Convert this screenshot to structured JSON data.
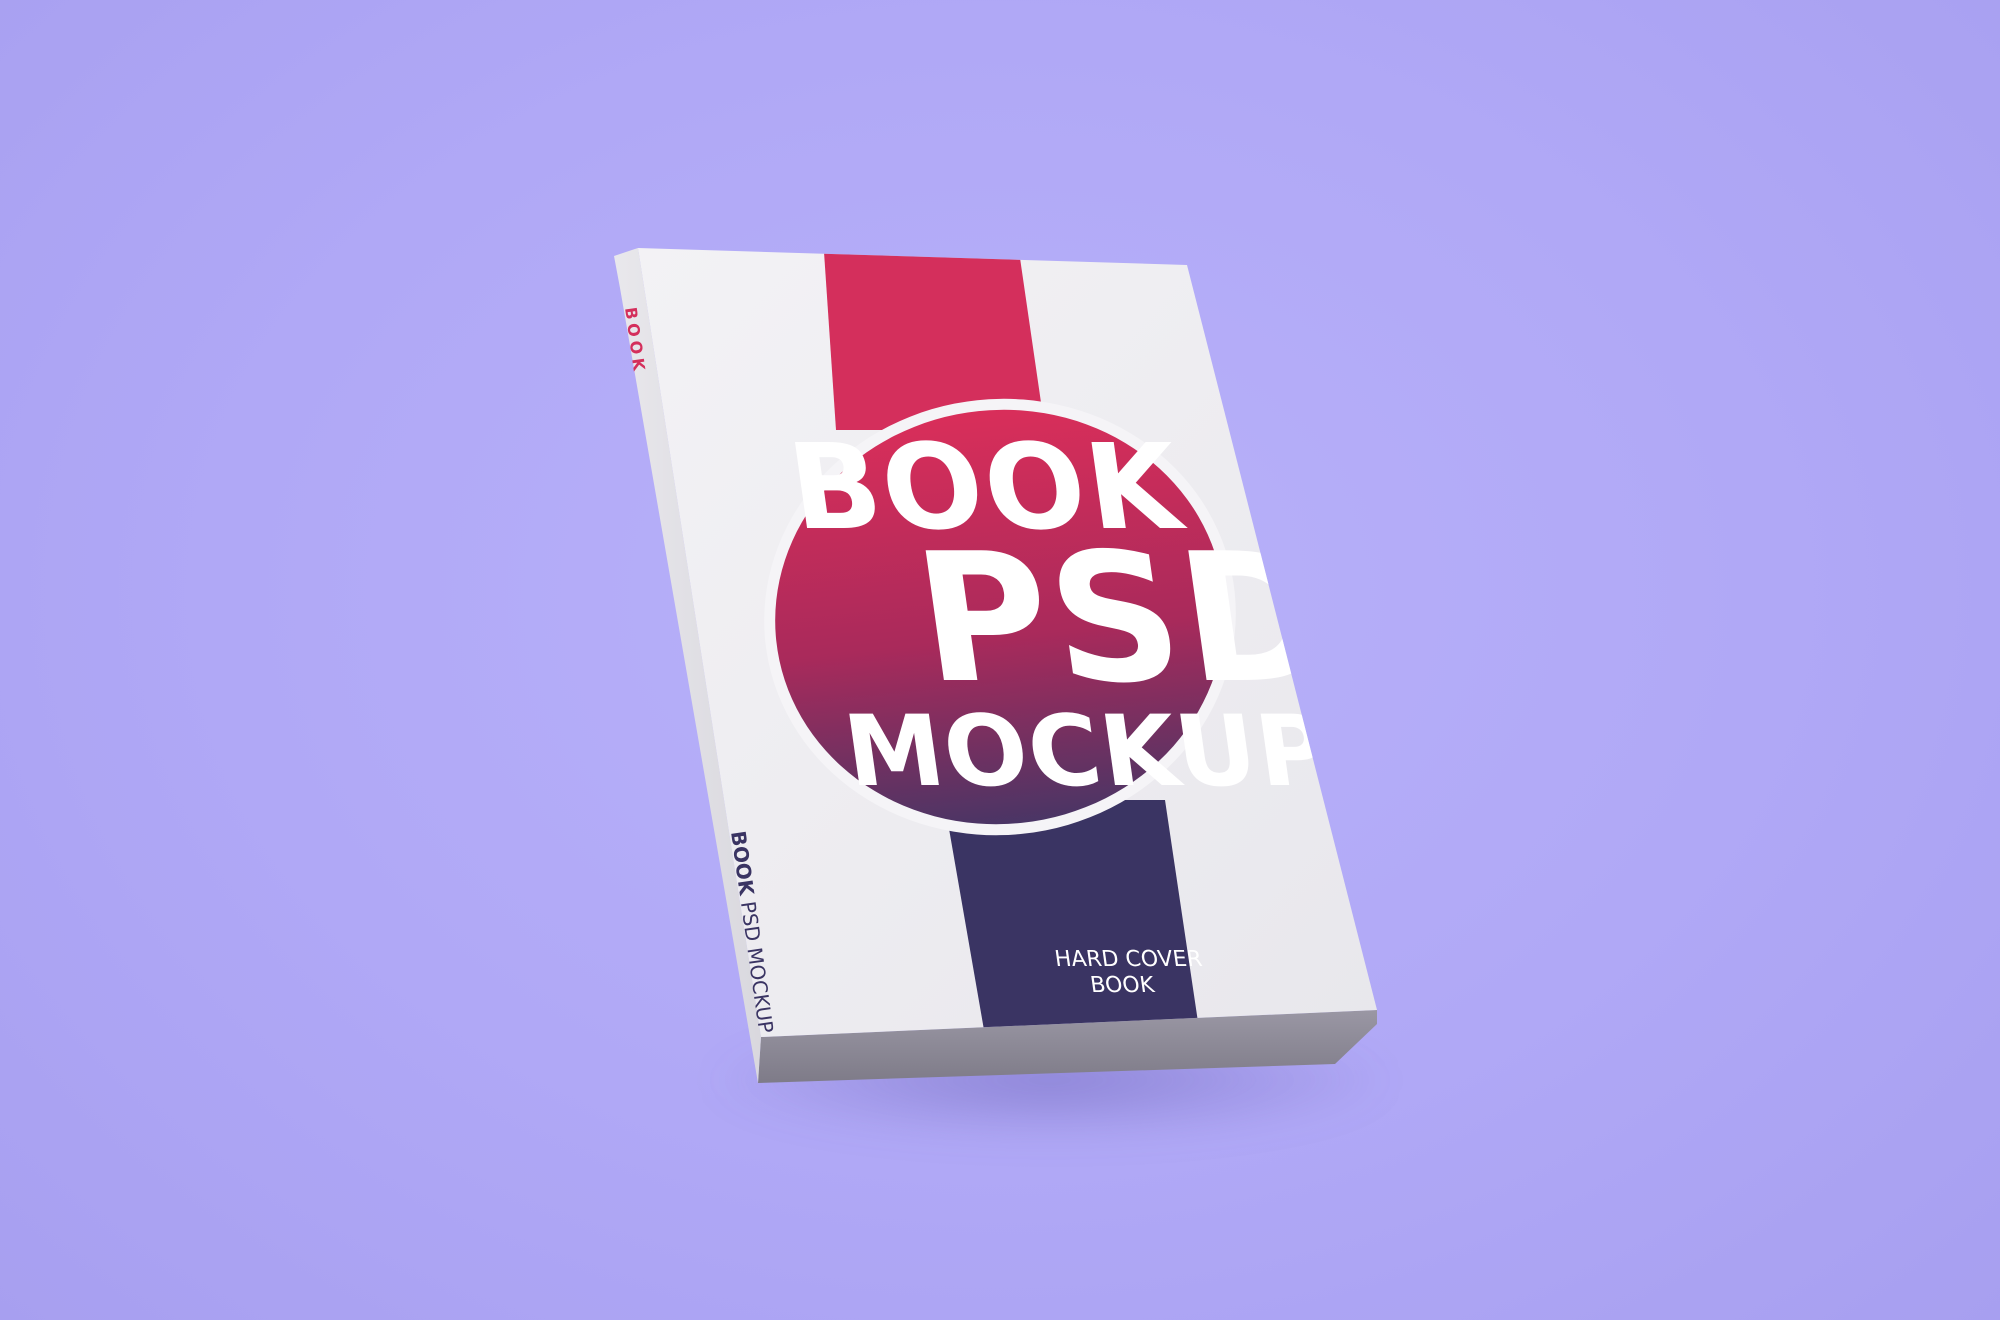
{
  "cover": {
    "title_line1": "BOOK",
    "title_line2": "PSD",
    "title_line3": "MOCKUP",
    "subtitle_line1": "HARD COVER",
    "subtitle_line2": "BOOK"
  },
  "spine": {
    "top_text": "BOOK",
    "main_bold": "BOOK",
    "main_rest": " PSD MOCKUP"
  },
  "colors": {
    "background": "#b1a9f6",
    "accent_red": "#d42f5c",
    "accent_navy": "#3a3463",
    "cover_white": "#f1f0f3"
  }
}
